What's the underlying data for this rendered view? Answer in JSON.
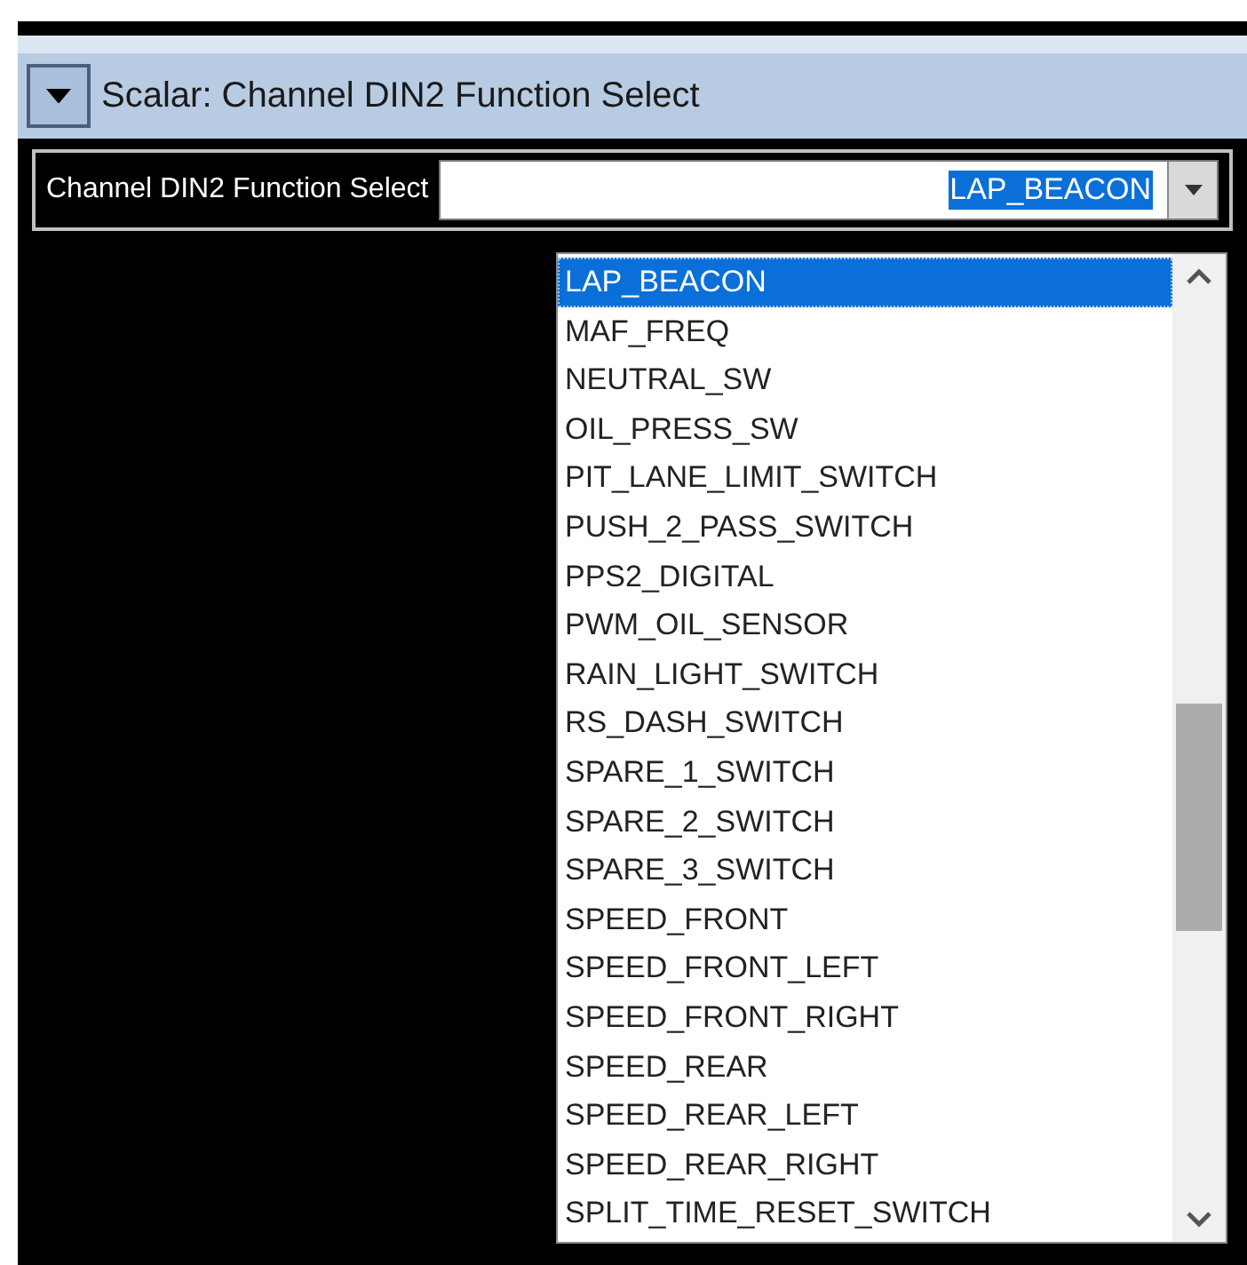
{
  "panel": {
    "title": "Scalar: Channel DIN2 Function Select",
    "expanded": true
  },
  "field": {
    "label": "Channel DIN2 Function Select",
    "value": "LAP_BEACON"
  },
  "dropdown": {
    "items": [
      {
        "label": "LAP_BEACON",
        "selected": true
      },
      {
        "label": "MAF_FREQ",
        "selected": false
      },
      {
        "label": "NEUTRAL_SW",
        "selected": false
      },
      {
        "label": "OIL_PRESS_SW",
        "selected": false
      },
      {
        "label": "PIT_LANE_LIMIT_SWITCH",
        "selected": false
      },
      {
        "label": "PUSH_2_PASS_SWITCH",
        "selected": false
      },
      {
        "label": "PPS2_DIGITAL",
        "selected": false
      },
      {
        "label": "PWM_OIL_SENSOR",
        "selected": false
      },
      {
        "label": "RAIN_LIGHT_SWITCH",
        "selected": false
      },
      {
        "label": "RS_DASH_SWITCH",
        "selected": false
      },
      {
        "label": "SPARE_1_SWITCH",
        "selected": false
      },
      {
        "label": "SPARE_2_SWITCH",
        "selected": false
      },
      {
        "label": "SPARE_3_SWITCH",
        "selected": false
      },
      {
        "label": "SPEED_FRONT",
        "selected": false
      },
      {
        "label": "SPEED_FRONT_LEFT",
        "selected": false
      },
      {
        "label": "SPEED_FRONT_RIGHT",
        "selected": false
      },
      {
        "label": "SPEED_REAR",
        "selected": false
      },
      {
        "label": "SPEED_REAR_LEFT",
        "selected": false
      },
      {
        "label": "SPEED_REAR_RIGHT",
        "selected": false
      },
      {
        "label": "SPLIT_TIME_RESET_SWITCH",
        "selected": false
      }
    ]
  }
}
